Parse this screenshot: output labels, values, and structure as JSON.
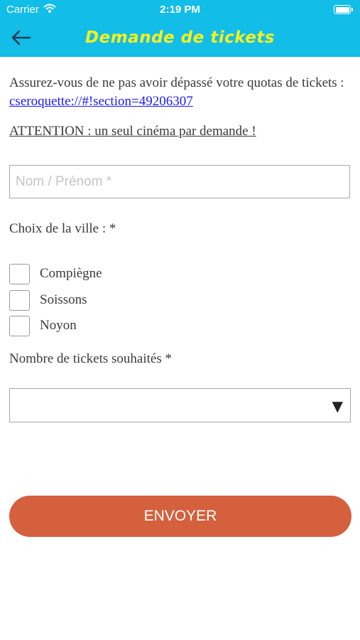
{
  "statusbar": {
    "carrier": "Carrier",
    "time": "2:19 PM"
  },
  "navbar": {
    "title": "Demande de tickets",
    "back_icon": "back-arrow-icon"
  },
  "intro": {
    "text": "Assurez-vous de ne pas avoir dépassé votre quotas de tickets : ",
    "link": "cseroquette://#!section=49206307"
  },
  "warning": "ATTENTION : un seul cinéma par demande !",
  "name_field": {
    "value": "",
    "placeholder": "Nom / Prénom *"
  },
  "city": {
    "label": "Choix de la ville : *",
    "options": [
      {
        "label": "Compiègne",
        "checked": false
      },
      {
        "label": "Soissons",
        "checked": false
      },
      {
        "label": "Noyon",
        "checked": false
      }
    ]
  },
  "tickets": {
    "label": "Nombre de tickets souhaités *",
    "selected": ""
  },
  "submit": {
    "label": "ENVOYER"
  },
  "colors": {
    "header": "#12bde8",
    "title": "#f6f01f",
    "button": "#d4603e",
    "link": "#1a1aff"
  }
}
